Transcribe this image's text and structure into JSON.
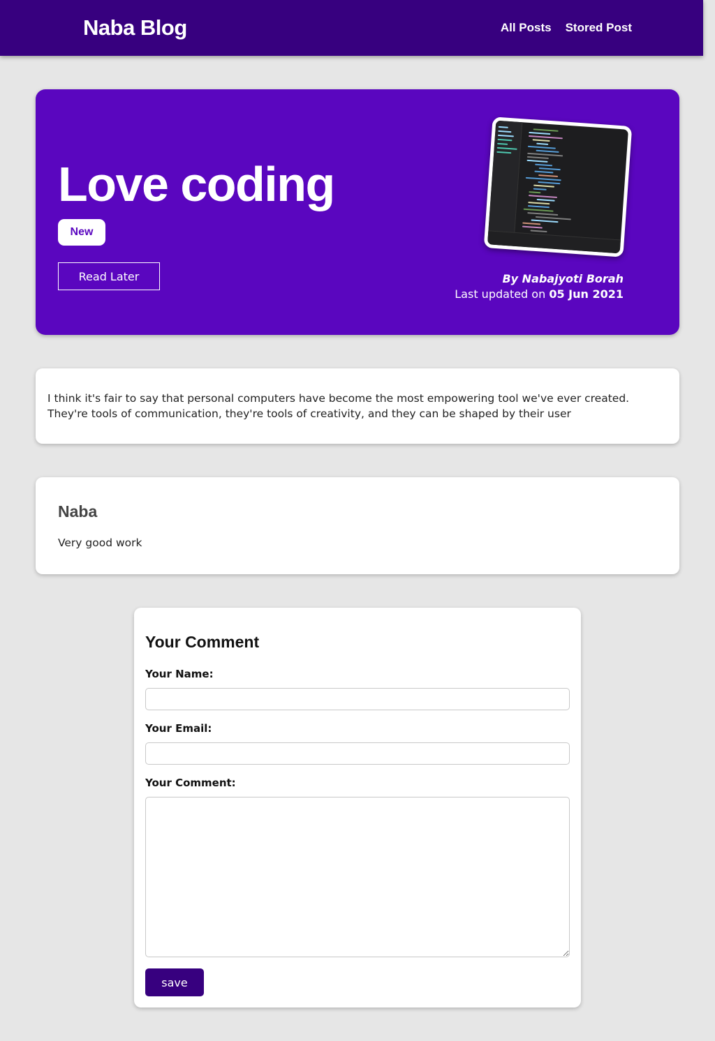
{
  "header": {
    "brand": "Naba Blog",
    "nav": [
      "All Posts",
      "Stored Post"
    ]
  },
  "post": {
    "title": "Love coding",
    "badge": "New",
    "read_later_label": "Read Later",
    "image_icon": "code-editor-screenshot",
    "author": "By Nabajyoti Borah",
    "updated_prefix": "Last updated on",
    "updated_date": "05 Jun 2021",
    "excerpt": "I think it's fair to say that personal computers have become the most empowering tool we've ever created. They're tools of communication, they're tools of creativity, and they can be shaped by their user"
  },
  "comments": [
    {
      "name": "Naba",
      "text": "Very good work"
    }
  ],
  "form": {
    "title": "Your Comment",
    "name_label": "Your Name:",
    "email_label": "Your Email:",
    "comment_label": "Your Comment:",
    "name_value": "",
    "email_value": "",
    "comment_value": "",
    "save_label": "save"
  },
  "colors": {
    "header_bg": "#37007f",
    "hero_bg": "#5a06bf",
    "page_bg": "#e6e6e6",
    "button_bg": "#37007f"
  }
}
